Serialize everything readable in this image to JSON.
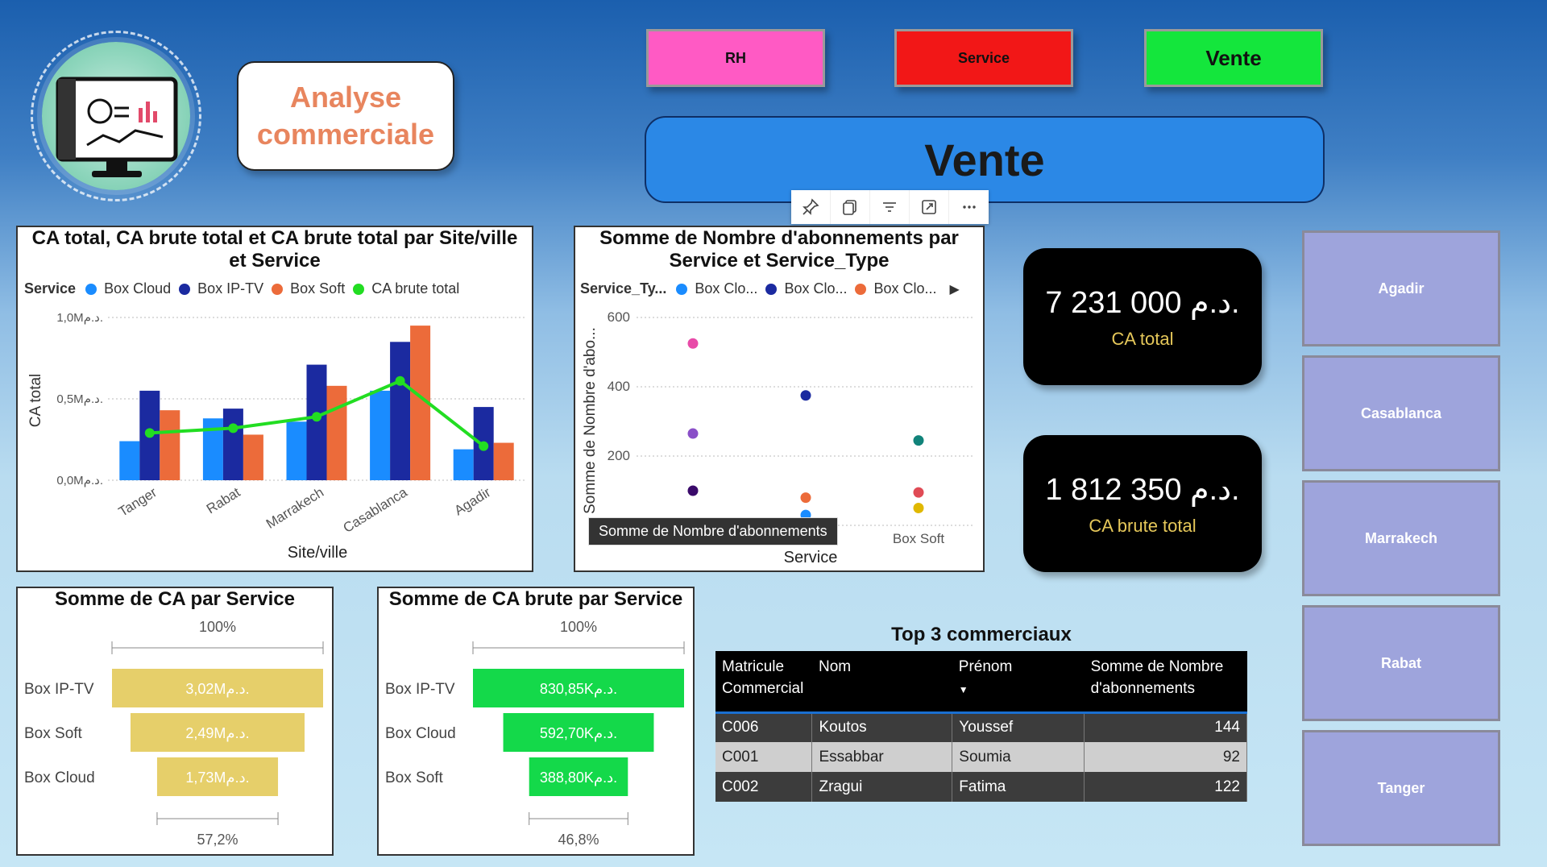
{
  "header": {
    "title_line1": "Analyse",
    "title_line2": "commerciale",
    "nav": [
      {
        "label": "RH",
        "color": "#ff5ac4"
      },
      {
        "label": "Service",
        "color": "#f21717"
      },
      {
        "label": "Vente",
        "color": "#14e63c"
      }
    ],
    "banner": "Vente"
  },
  "colors": {
    "box_cloud": "#1a8cff",
    "box_iptv": "#1b2aa0",
    "box_soft": "#ec6b3a",
    "ca_brute_line": "#22dd22",
    "funnel_ca": "#e6cf6a",
    "funnel_brute": "#14d94a"
  },
  "combo_chart": {
    "title": "CA total, CA brute total et CA brute total par Site/ville et Service",
    "legend_label": "Service",
    "legend": [
      "Box Cloud",
      "Box IP-TV",
      "Box Soft",
      "CA brute total"
    ],
    "y_axis_label": "CA total",
    "x_axis_label": "Site/ville",
    "y_ticks": [
      "1,0Mد.م.",
      "0,5Mد.م.",
      "0,0Mد.م."
    ]
  },
  "scatter_chart": {
    "title": "Somme de Nombre d'abonnements par Service et Service_Type",
    "legend_label": "Service_Ty...",
    "legend": [
      "Box Clo...",
      "Box Clo...",
      "Box Clo..."
    ],
    "y_axis_label": "Somme de Nombre d'abo...",
    "x_axis_label": "Service",
    "y_ticks": [
      "600",
      "400",
      "200"
    ],
    "x_visible_label": "Box Soft",
    "tooltip": "Somme de Nombre d'abonnements"
  },
  "kpis": [
    {
      "value": "7 231 000 د.م.",
      "label": "CA total"
    },
    {
      "value": "1 812 350 د.م.",
      "label": "CA brute total"
    }
  ],
  "cities": [
    "Agadir",
    "Casablanca",
    "Marrakech",
    "Rabat",
    "Tanger"
  ],
  "funnel_ca": {
    "title": "Somme de CA par Service",
    "top_pct": "100%",
    "bottom_pct": "57,2%",
    "rows": [
      {
        "label": "Box IP-TV",
        "value_text": "3,02Mد.م."
      },
      {
        "label": "Box Soft",
        "value_text": "2,49Mد.م."
      },
      {
        "label": "Box Cloud",
        "value_text": "1,73Mد.م."
      }
    ]
  },
  "funnel_brute": {
    "title": "Somme de CA brute par Service",
    "top_pct": "100%",
    "bottom_pct": "46,8%",
    "rows": [
      {
        "label": "Box IP-TV",
        "value_text": "830,85Kد.م."
      },
      {
        "label": "Box Cloud",
        "value_text": "592,70Kد.م."
      },
      {
        "label": "Box Soft",
        "value_text": "388,80Kد.م."
      }
    ]
  },
  "top3": {
    "title": "Top 3 commerciaux",
    "columns": [
      "Matricule Commercial",
      "Nom",
      "Prénom",
      "Somme de Nombre d'abonnements"
    ],
    "rows": [
      [
        "C006",
        "Koutos",
        "Youssef",
        "144"
      ],
      [
        "C001",
        "Essabbar",
        "Soumia",
        "92"
      ],
      [
        "C002",
        "Zragui",
        "Fatima",
        "122"
      ]
    ]
  },
  "chart_data": [
    {
      "type": "bar",
      "title": "CA total, CA brute total et CA brute total par Site/ville et Service",
      "xlabel": "Site/ville",
      "ylabel": "CA total",
      "categories": [
        "Tanger",
        "Rabat",
        "Marrakech",
        "Casablanca",
        "Agadir"
      ],
      "ylim": [
        0,
        1000000
      ],
      "series": [
        {
          "name": "Box Cloud",
          "values": [
            240000,
            380000,
            360000,
            550000,
            190000
          ]
        },
        {
          "name": "Box IP-TV",
          "values": [
            550000,
            440000,
            710000,
            850000,
            450000
          ]
        },
        {
          "name": "Box Soft",
          "values": [
            430000,
            280000,
            580000,
            950000,
            230000
          ]
        },
        {
          "name": "CA brute total",
          "type": "line",
          "values": [
            290000,
            320000,
            390000,
            610000,
            210000
          ]
        }
      ],
      "legend": "top-left",
      "grid": true
    },
    {
      "type": "scatter",
      "title": "Somme de Nombre d'abonnements par Service et Service_Type",
      "xlabel": "Service",
      "ylabel": "Somme de Nombre d'abo...",
      "ylim": [
        0,
        600
      ],
      "points": [
        {
          "x": 0,
          "y": 525,
          "color": "#e84aa8"
        },
        {
          "x": 0,
          "y": 265,
          "color": "#8a4fc8"
        },
        {
          "x": 0,
          "y": 100,
          "color": "#3a0a6a"
        },
        {
          "x": 1,
          "y": 375,
          "color": "#1b2aa0"
        },
        {
          "x": 1,
          "y": 80,
          "color": "#ec6b3a"
        },
        {
          "x": 1,
          "y": 30,
          "color": "#1a8cff"
        },
        {
          "x": 2,
          "y": 245,
          "color": "#11837a"
        },
        {
          "x": 2,
          "y": 95,
          "color": "#e04b55"
        },
        {
          "x": 2,
          "y": 50,
          "color": "#e0b800"
        }
      ],
      "x_categories": [
        "",
        "",
        "Box Soft"
      ]
    },
    {
      "type": "bar",
      "title": "Somme de CA par Service",
      "categories": [
        "Box IP-TV",
        "Box Soft",
        "Box Cloud"
      ],
      "values": [
        3020000,
        2490000,
        1730000
      ]
    },
    {
      "type": "bar",
      "title": "Somme de CA brute par Service",
      "categories": [
        "Box IP-TV",
        "Box Cloud",
        "Box Soft"
      ],
      "values": [
        830850,
        592700,
        388800
      ]
    }
  ]
}
